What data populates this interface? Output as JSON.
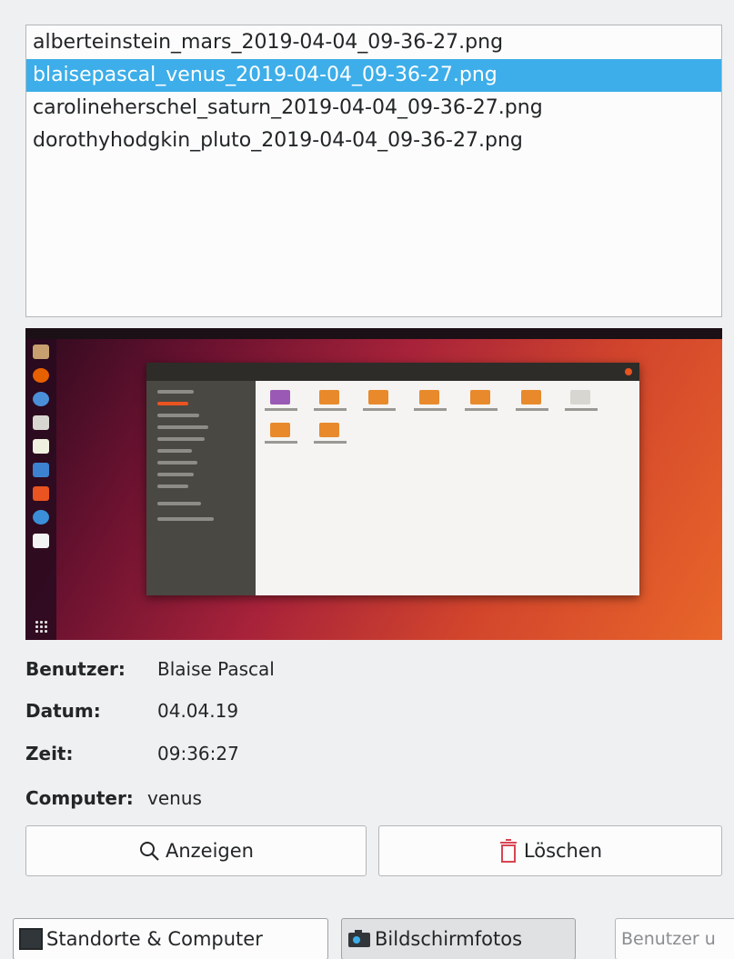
{
  "file_list": {
    "items": [
      {
        "name": "alberteinstein_mars_2019-04-04_09-36-27.png",
        "selected": false
      },
      {
        "name": "blaisepascal_venus_2019-04-04_09-36-27.png",
        "selected": true
      },
      {
        "name": "carolineherschel_saturn_2019-04-04_09-36-27.png",
        "selected": false
      },
      {
        "name": "dorothyhodgkin_pluto_2019-04-04_09-36-27.png",
        "selected": false
      }
    ]
  },
  "preview": {
    "icon": "desktop-screenshot-thumbnail"
  },
  "details": {
    "user_label": "Benutzer:",
    "user_value": "Blaise Pascal",
    "date_label": "Datum:",
    "date_value": "04.04.19",
    "time_label": "Zeit:",
    "time_value": "09:36:27",
    "computer_label": "Computer:",
    "computer_value": "venus"
  },
  "actions": {
    "show_label": "Anzeigen",
    "show_icon": "magnifier-icon",
    "delete_label": "Löschen",
    "delete_icon": "trash-icon",
    "delete_color": "#da4453"
  },
  "bottom_bar": {
    "locations_label": "Standorte & Computer",
    "locations_icon": "monitor-icon",
    "screenshots_label": "Bildschirmfotos",
    "screenshots_icon": "camera-icon",
    "search_placeholder": "Benutzer u"
  },
  "colors": {
    "selection": "#3daee9",
    "window_bg": "#eff0f1"
  }
}
